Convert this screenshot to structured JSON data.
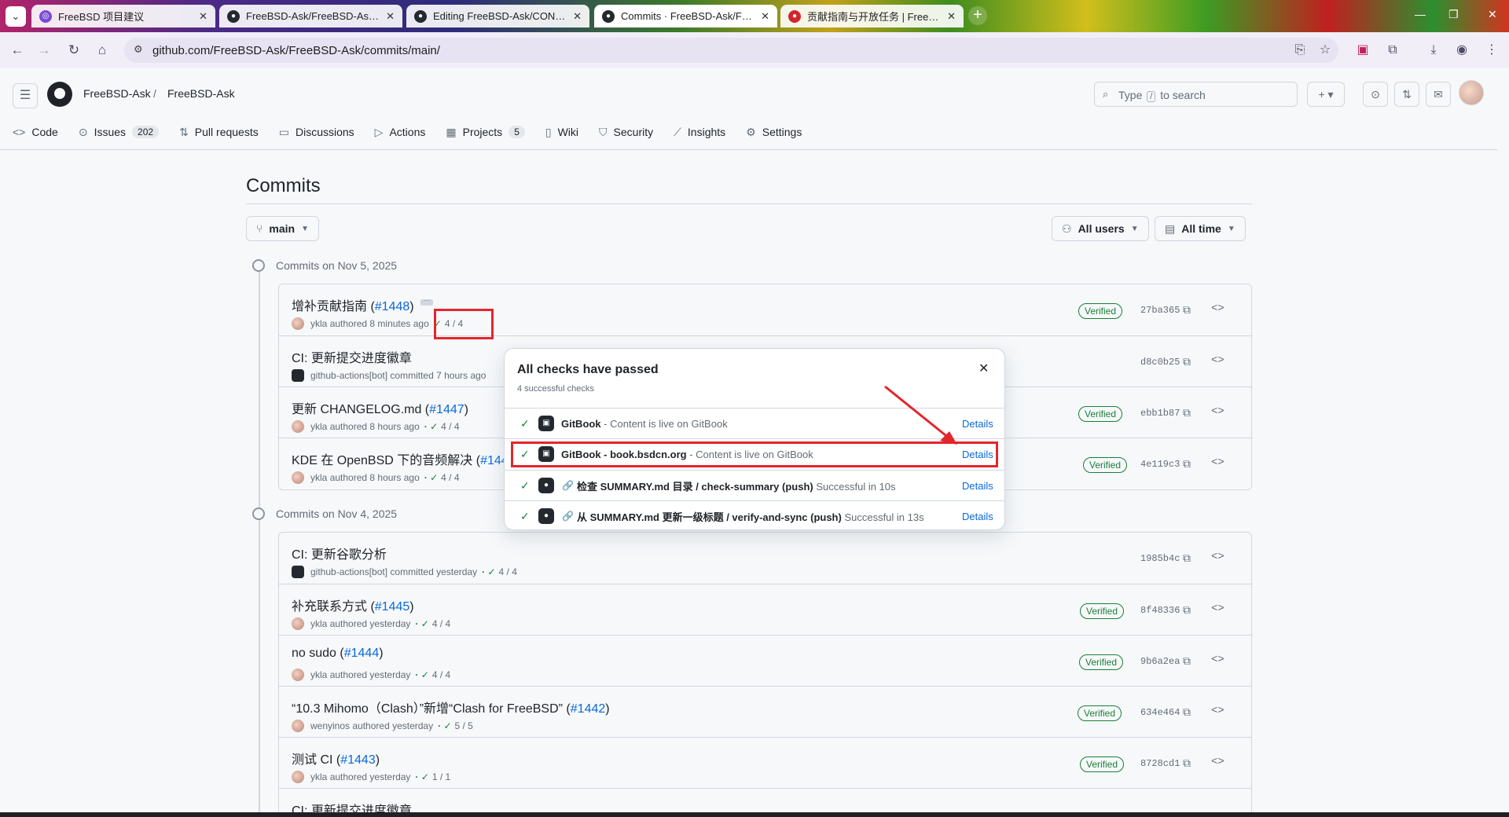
{
  "browser": {
    "tabs": [
      {
        "title": "FreeBSD 项目建议"
      },
      {
        "title": "FreeBSD-Ask/FreeBSD-Ask.git"
      },
      {
        "title": "Editing FreeBSD-Ask/CONTR"
      },
      {
        "title": "Commits · FreeBSD-Ask/Free"
      },
      {
        "title": "贡献指南与开放任务 | FreeBSD"
      }
    ],
    "url": "github.com/FreeBSD-Ask/FreeBSD-Ask/commits/main/"
  },
  "header": {
    "owner": "FreeBSD-Ask",
    "repo": "FreeBSD-Ask",
    "search_prefix": "Type",
    "search_key": "/",
    "search_suffix": "to search"
  },
  "repo_nav": [
    {
      "label": "Code",
      "icon": "code-icon"
    },
    {
      "label": "Issues",
      "icon": "issue-icon",
      "count": "202"
    },
    {
      "label": "Pull requests",
      "icon": "pull-request-icon"
    },
    {
      "label": "Discussions",
      "icon": "discussion-icon"
    },
    {
      "label": "Actions",
      "icon": "play-icon"
    },
    {
      "label": "Projects",
      "icon": "table-icon",
      "count": "5"
    },
    {
      "label": "Wiki",
      "icon": "book-icon"
    },
    {
      "label": "Security",
      "icon": "shield-icon"
    },
    {
      "label": "Insights",
      "icon": "graph-icon"
    },
    {
      "label": "Settings",
      "icon": "gear-icon"
    }
  ],
  "page": {
    "title": "Commits",
    "branch": "main",
    "users_filter": "All users",
    "time_filter": "All time"
  },
  "groups": [
    {
      "heading": "Commits on Nov 5, 2025",
      "commits": [
        {
          "title": "增补贡献指南 (",
          "pr": "#1448",
          "close": ")",
          "author": "ykla",
          "action": "authored 8 minutes ago",
          "checks": "4 / 4",
          "verified": "Verified",
          "sha": "27ba365"
        },
        {
          "title": "CI: 更新提交进度徽章",
          "pr": "",
          "close": "",
          "author": "github-actions[bot]",
          "action": "committed 7 hours ago",
          "checks": "",
          "verified": "",
          "sha": "d8c0b25"
        },
        {
          "title": "更新 CHANGELOG.md (",
          "pr": "#1447",
          "close": ")",
          "author": "ykla",
          "action": "authored 8 hours ago",
          "checks": "4 / 4",
          "verified": "Verified",
          "sha": "ebb1b87"
        },
        {
          "title": "KDE 在 OpenBSD 下的音频解决 (",
          "pr": "#144",
          "close": "",
          "author": "ykla",
          "action": "authored 8 hours ago",
          "checks": "4 / 4",
          "verified": "Verified",
          "sha": "4e119c3"
        }
      ]
    },
    {
      "heading": "Commits on Nov 4, 2025",
      "commits": [
        {
          "title": "CI: 更新谷歌分析",
          "pr": "",
          "close": "",
          "author": "github-actions[bot]",
          "action": "committed yesterday",
          "checks": "4 / 4",
          "verified": "",
          "sha": "1985b4c"
        },
        {
          "title": "补充联系方式 (",
          "pr": "#1445",
          "close": ")",
          "author": "ykla",
          "action": "authored yesterday",
          "checks": "4 / 4",
          "verified": "Verified",
          "sha": "8f48336"
        },
        {
          "title": "no sudo (",
          "pr": "#1444",
          "close": ")",
          "author": "ykla",
          "action": "authored yesterday",
          "checks": "4 / 4",
          "verified": "Verified",
          "sha": "9b6a2ea"
        },
        {
          "title": "“10.3 Mihomo（Clash）”新增“Clash for FreeBSD” (",
          "pr": "#1442",
          "close": ")",
          "author": "wenyinos",
          "action": "authored yesterday",
          "checks": "5 / 5",
          "verified": "Verified",
          "sha": "634e464"
        },
        {
          "title": "测试 CI (",
          "pr": "#1443",
          "close": ")",
          "author": "ykla",
          "action": "authored yesterday",
          "checks": "1 / 1",
          "verified": "Verified",
          "sha": "8728cd1"
        },
        {
          "title": "CI: 更新提交进度徽章",
          "pr": "",
          "close": "",
          "author": "",
          "action": "",
          "checks": "",
          "verified": "",
          "sha": ""
        }
      ]
    }
  ],
  "popover": {
    "title": "All checks have passed",
    "subtitle": "4 successful checks",
    "checks": [
      {
        "name": "GitBook",
        "desc": " - Content is live on GitBook",
        "details": "Details"
      },
      {
        "name": "GitBook - book.bsdcn.org",
        "desc": " - Content is live on GitBook",
        "details": "Details"
      },
      {
        "name": "检查 SUMMARY.md 目录 / check-summary (push)",
        "desc": " Successful in 10s",
        "details": "Details"
      },
      {
        "name": "从 SUMMARY.md 更新一级标题 / verify-and-sync (push)",
        "desc": " Successful in 13s",
        "details": "Details"
      }
    ]
  },
  "colors": {
    "accent": "#0969da",
    "success": "#1a7f37",
    "annotation": "#e3262d"
  }
}
